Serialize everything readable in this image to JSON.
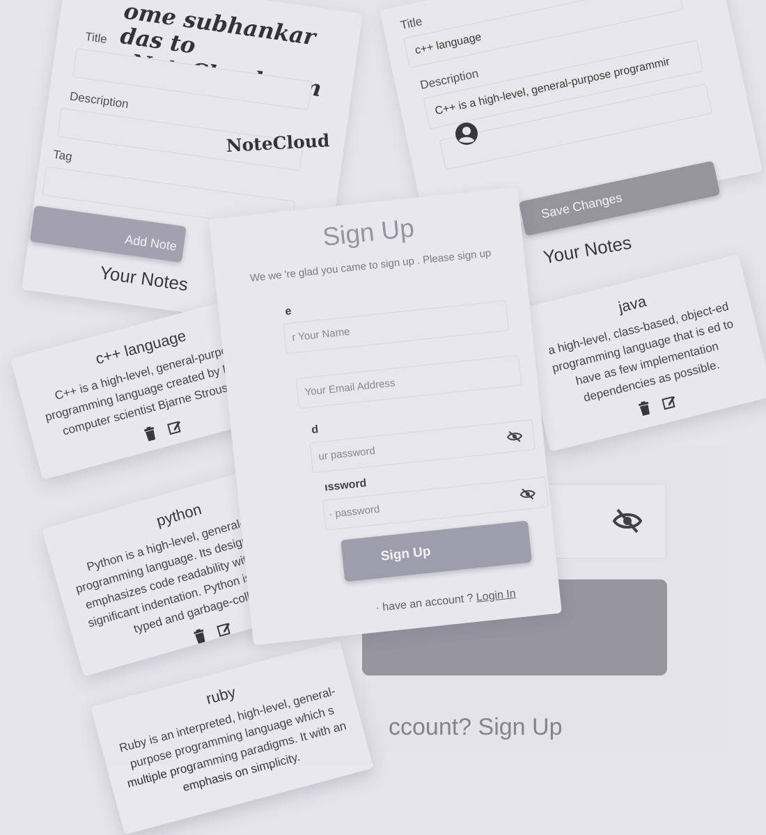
{
  "top_left": {
    "welcome_line1": "ome subhankar das to",
    "welcome_line2": "NoteCloud.com",
    "title_label": "Title",
    "description_label": "Description",
    "tag_label": "Tag",
    "add_note_button": "Add Note",
    "your_notes": "Your Notes"
  },
  "top_right": {
    "title_label": "Title",
    "title_value": "c++ language",
    "description_label": "Description",
    "description_value": "C++ is a high-level, general-purpose programmir",
    "save_button": "Save Changes",
    "your_notes": "Your Notes"
  },
  "navbar": {
    "brand": "NoteCloud",
    "profile_icon": "account-circle-icon"
  },
  "signup": {
    "heading": "Sign Up",
    "subtitle": "We we 're glad you came to sign up . Please sign up",
    "name_label": "e",
    "name_placeholder": "r Your Name",
    "email_placeholder": "Your Email Address",
    "password_label": "d",
    "password_placeholder": "ur password",
    "confirm_label": "ıssword",
    "confirm_placeholder": "· password",
    "button": "Sign Up",
    "footer_text": "· have an account ?",
    "login_link": "Login In"
  },
  "notes": [
    {
      "title": "c++ language",
      "description": "C++ is a high-level, general-purpose programming language created by Danish computer scientist Bjarne Stroustrup."
    },
    {
      "title": "python",
      "description": "Python is a high-level, general-purpose programming language. Its design philosophy emphasizes code readability with the use of significant indentation. Python is dynamically typed and garbage-collected"
    },
    {
      "title": "java",
      "description": "a high-level, class-based, object-ed programming language that is ed to have as few implementation dependencies as possible."
    },
    {
      "title": "ruby",
      "description": "Ruby is an interpreted, high-level, general-purpose programming language which s multiple programming paradigms. It with an emphasis on simplicity."
    }
  ],
  "bottom_right": {
    "login_text": "ccount? Sign Up",
    "eye_icon": "eye-off-icon"
  },
  "icons": {
    "delete": "trash-icon",
    "edit": "edit-icon"
  }
}
